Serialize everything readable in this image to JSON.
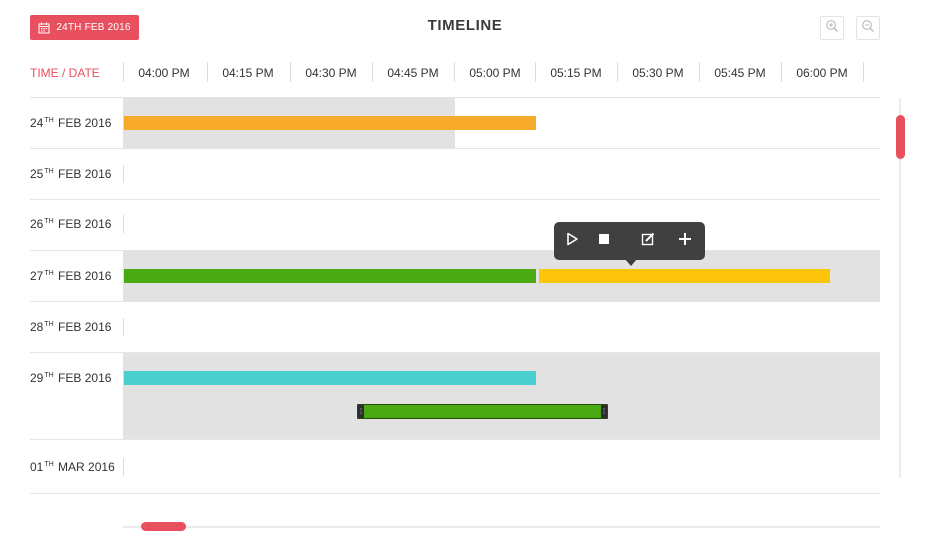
{
  "header": {
    "date_button_label": "24TH FEB 2016",
    "title": "TIMELINE",
    "zoom_in_icon": "zoom-in-icon",
    "zoom_out_icon": "zoom-out-icon",
    "accent_color": "#e8505f"
  },
  "axis": {
    "corner_label": "TIME / DATE",
    "ticks": [
      "04:00 PM",
      "04:15 PM",
      "04:30 PM",
      "04:45 PM",
      "05:00 PM",
      "05:15 PM",
      "05:30 PM",
      "05:45 PM",
      "06:00 PM"
    ]
  },
  "rows": [
    {
      "day": "24",
      "suffix": "TH",
      "month_year": "FEB 2016"
    },
    {
      "day": "25",
      "suffix": "TH",
      "month_year": "FEB 2016"
    },
    {
      "day": "26",
      "suffix": "TH",
      "month_year": "FEB 2016"
    },
    {
      "day": "27",
      "suffix": "TH",
      "month_year": "FEB 2016"
    },
    {
      "day": "28",
      "suffix": "TH",
      "month_year": "FEB 2016"
    },
    {
      "day": "29",
      "suffix": "TH",
      "month_year": "FEB 2016"
    },
    {
      "day": "01",
      "suffix": "TH",
      "month_year": "MAR 2016"
    }
  ],
  "bar_colors": {
    "orange": "#f8ab2b",
    "green": "#4aaa14",
    "yellow": "#fcc40a",
    "teal": "#4bcfcf"
  },
  "toolbar": {
    "play_icon": "play-icon",
    "stop_icon": "stop-icon",
    "edit_icon": "edit-icon",
    "add_icon": "plus-icon"
  }
}
